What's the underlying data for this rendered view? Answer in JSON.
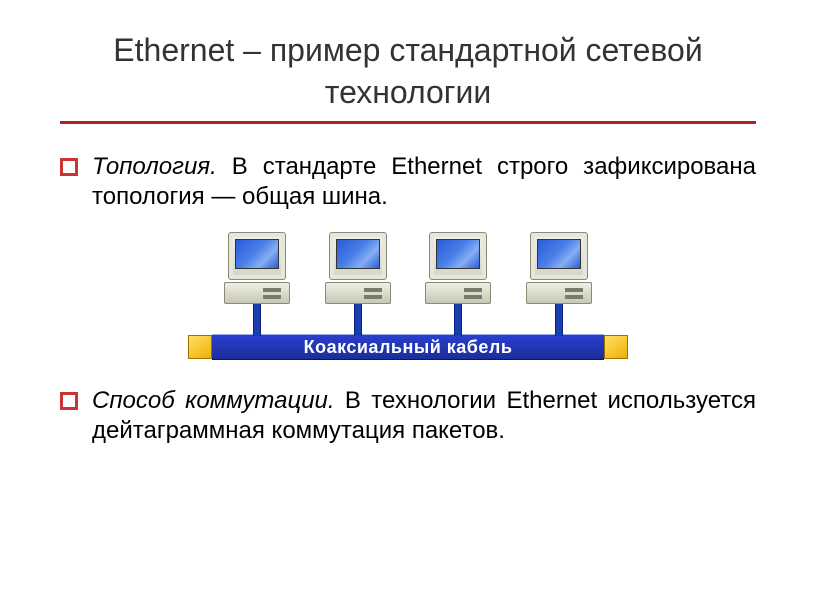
{
  "title": "Ethernet – пример стандартной сетевой технологии",
  "bullets": [
    {
      "lead": "Топология.",
      "rest": " В стандарте Ethernet строго зафиксирована топология — общая шина."
    },
    {
      "lead": "Способ коммутации.",
      "rest": " В технологии Ethernet используется дейтаграммная коммутация пакетов."
    }
  ],
  "diagram": {
    "cable_label": "Коаксиальный кабель"
  }
}
